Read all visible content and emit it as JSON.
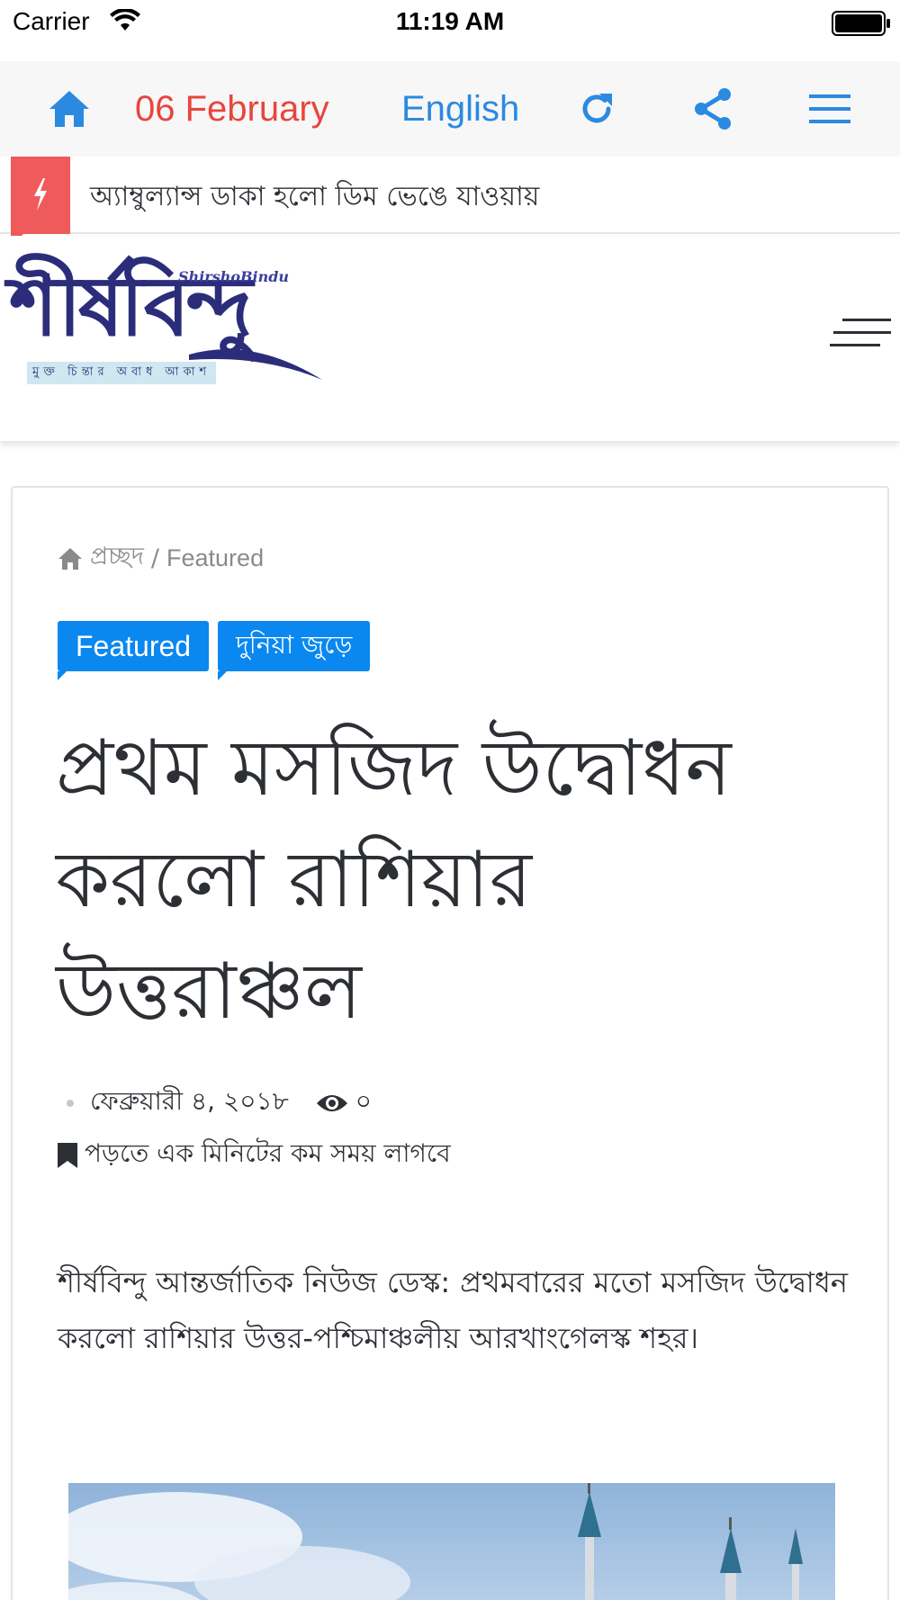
{
  "status_bar": {
    "carrier": "Carrier",
    "time": "11:19 AM",
    "wifi_icon": "wifi-icon",
    "battery_icon": "battery-icon"
  },
  "toolbar": {
    "home_icon": "home-icon",
    "date": "06 February",
    "language": "English",
    "refresh_icon": "refresh-icon",
    "share_icon": "share-icon",
    "menu_icon": "menu-icon"
  },
  "ticker": {
    "icon": "bolt-icon",
    "headline": "অ্যাম্বুল্যান্স ডাকা হলো ডিম ভেঙে যাওয়ায়"
  },
  "site": {
    "logo_text": "শীর্ষবিন্দু",
    "logo_latin": "ShirshoBindu",
    "logo_tagline": "মুক্ত চিন্তার অবাধ আকাশ"
  },
  "article": {
    "breadcrumb": {
      "home": "প্রচ্ছদ",
      "separator": "/",
      "current": "Featured"
    },
    "tags": [
      "Featured",
      "দুনিয়া জুড়ে"
    ],
    "title": "প্রথম মসজিদ উদ্বোধন করলো রাশিয়ার উত্তরাঞ্চল",
    "date": "ফেব্রুয়ারী ৪, ২০১৮",
    "views": "০",
    "read_time": "পড়তে এক মিনিটের কম সময় লাগবে",
    "body": "শীর্ষবিন্দু আন্তর্জাতিক নিউজ ডেস্ক: প্রথমবারের মতো মসজিদ উদ্বোধন করলো রাশিয়ার উত্তর-পশ্চিমাঞ্চলীয় আরখাংগেলস্ক শহর।"
  },
  "colors": {
    "accent_red": "#e8453c",
    "accent_blue": "#2b8ae0",
    "tag_blue": "#0a88f0",
    "ticker_red": "#ef5a5a",
    "logo_navy": "#2b2d7a"
  }
}
